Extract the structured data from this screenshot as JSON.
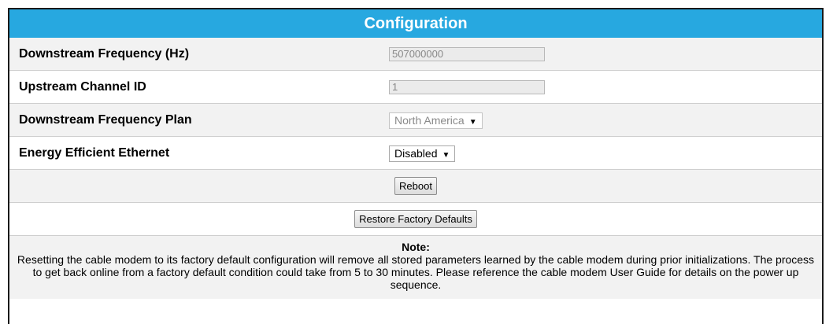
{
  "header": {
    "title": "Configuration"
  },
  "rows": [
    {
      "label": "Downstream Frequency (Hz)",
      "value": "507000000"
    },
    {
      "label": "Upstream Channel ID",
      "value": "1"
    },
    {
      "label": "Downstream Frequency Plan",
      "selected": "North America"
    },
    {
      "label": "Energy Efficient Ethernet",
      "selected": "Disabled"
    }
  ],
  "buttons": {
    "reboot": "Reboot",
    "restore": "Restore Factory Defaults"
  },
  "note": {
    "title": "Note:",
    "text": "Resetting the cable modem to its factory default configuration will remove all stored parameters learned by the cable modem during prior initializations. The process to get back online from a factory default condition could take from 5 to 30 minutes. Please reference the cable modem User Guide for details on the power up sequence."
  },
  "colors": {
    "header_bg": "#27a8e0",
    "header_text": "#ffffff",
    "row_alt": "#f2f2f2"
  },
  "icons": {
    "dropdown": "triangle-down-icon"
  }
}
